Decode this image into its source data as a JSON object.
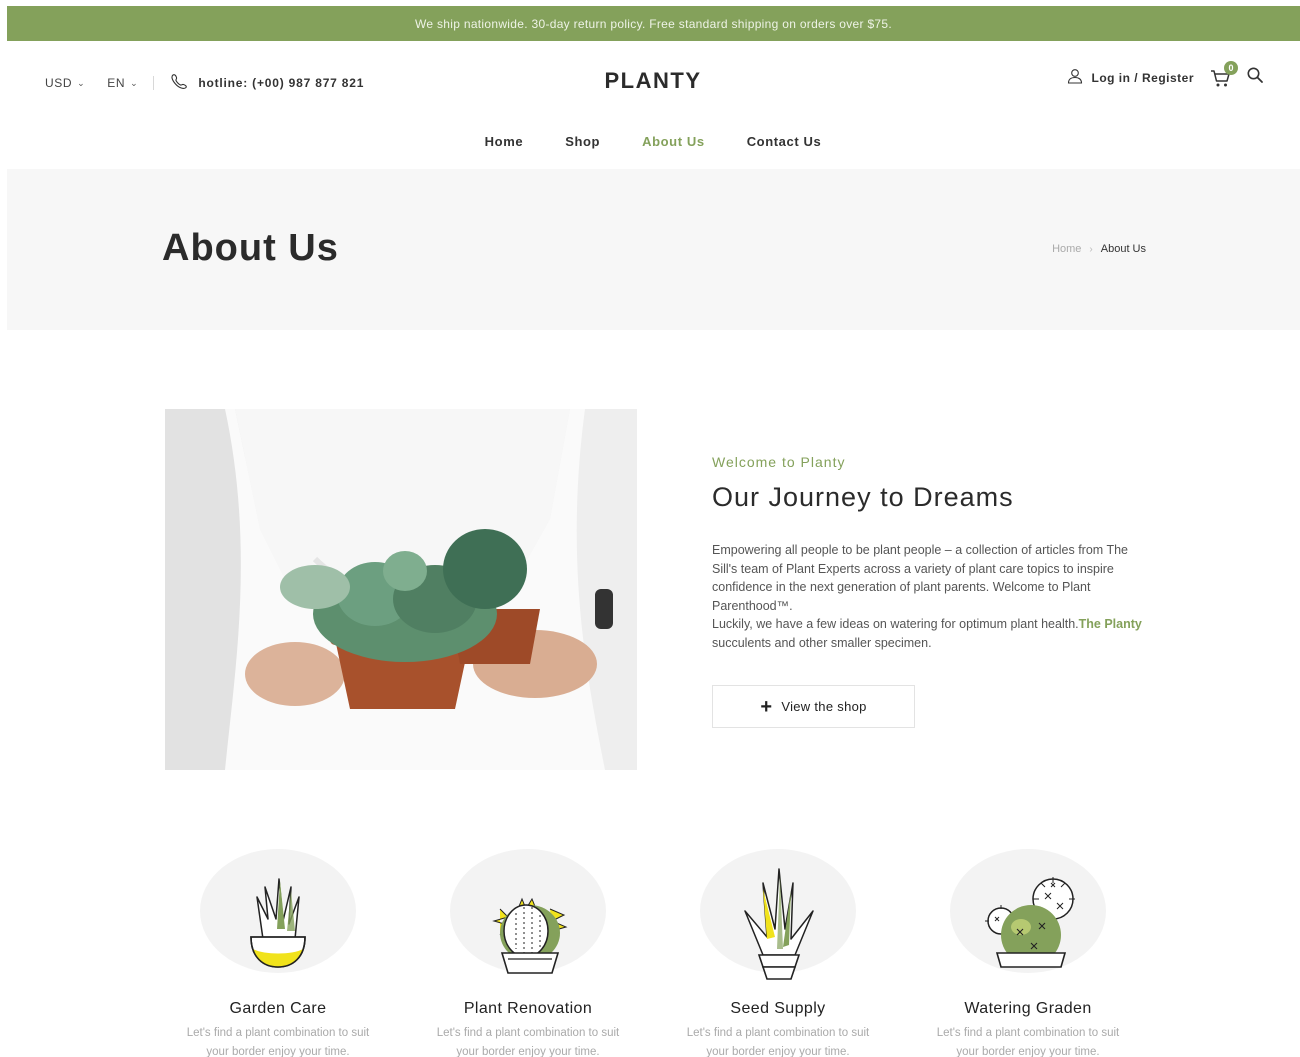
{
  "topbar": {
    "text": "We ship nationwide. 30-day return policy. Free standard shipping on orders over $75."
  },
  "header": {
    "currency": "USD",
    "language": "EN",
    "hotline": "hotline: (+00) 987 877 821",
    "logo": "PLANTY",
    "login": "Log in / Register",
    "cart_count": "0",
    "icons": {
      "phone": "phone-icon",
      "user": "user-icon",
      "cart": "cart-icon",
      "search": "search-icon"
    }
  },
  "nav": {
    "items": [
      {
        "label": "Home"
      },
      {
        "label": "Shop"
      },
      {
        "label": "About Us"
      },
      {
        "label": "Contact Us"
      }
    ]
  },
  "hero": {
    "title": "About Us",
    "breadcrumb_home": "Home",
    "breadcrumb_current": "About Us"
  },
  "intro": {
    "eyebrow": "Welcome to Planty",
    "heading": "Our Journey to Dreams",
    "paragraph_1": "Empowering all people to be plant people – a collection of articles from The Sill's team of Plant Experts across a variety of plant care topics to inspire confidence in the next generation of plant parents. Welcome to Plant Parenthood™.",
    "paragraph_2_pre": "Luckily, we have a few ideas on watering for optimum plant health.",
    "paragraph_2_highlight": "The Planty",
    "paragraph_2_post": " succulents and other smaller specimen.",
    "button": "View the shop"
  },
  "features": [
    {
      "title": "Garden Care",
      "text_1": "Let's find a plant combination to suit",
      "text_2": "your border enjoy your time."
    },
    {
      "title": "Plant Renovation",
      "text_1": "Let's find a plant combination to suit",
      "text_2": "your border enjoy your time."
    },
    {
      "title": "Seed Supply",
      "text_1": "Let's find a plant combination to suit",
      "text_2": "your border enjoy your time."
    },
    {
      "title": "Watering Graden",
      "text_1": "Let's find a plant combination to suit",
      "text_2": "your border enjoy your time."
    }
  ],
  "colors": {
    "accent": "#84a15b",
    "yellow": "#f1e31c",
    "dark": "#2b2b2b"
  }
}
